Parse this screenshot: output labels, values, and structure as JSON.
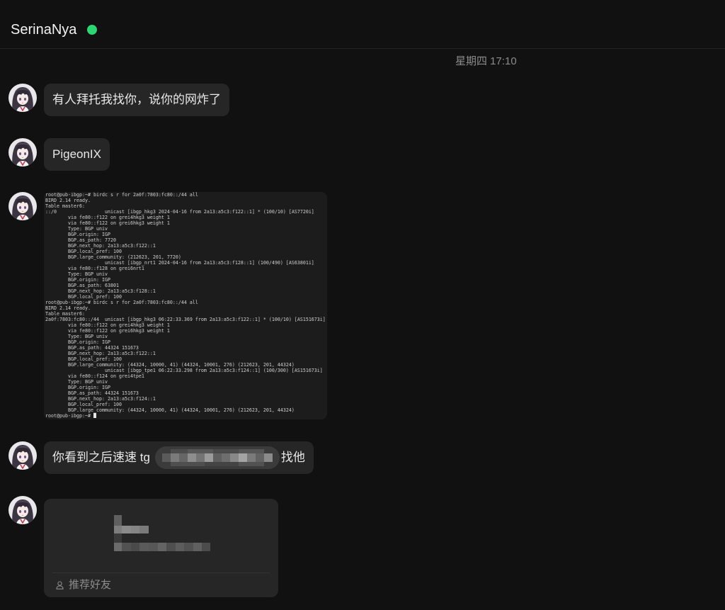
{
  "header": {
    "title": "SerinaNya",
    "status_icon": "online-dot-icon"
  },
  "timestamp": "星期四 17:10",
  "messages": [
    {
      "text": "有人拜托我找你，说你的网炸了"
    },
    {
      "text": "PigeonIX"
    },
    {
      "terminal_lines": [
        "root@pub-ibgp:~# birdc s r for 2a0f:7803:fc80::/44 all",
        "BIRD 2.14 ready.",
        "Table master6:",
        "::/0                 unicast [ibgp_hkg3 2024-04-16 from 2a13:a5c3:f122::1] * (100/10) [AS7720i]",
        "\tvia fe80::f122 on grei4hkg3 weight 1",
        "\tvia fe80::f122 on grei6hkg3 weight 1",
        "\tType: BGP univ",
        "\tBGP.origin: IGP",
        "\tBGP.as_path: 7720",
        "\tBGP.next_hop: 2a13:a5c3:f122::1",
        "\tBGP.local_pref: 100",
        "\tBGP.large_community: (212623, 201, 7720)",
        "                     unicast [ibgp_nrt1 2024-04-16 from 2a13:a5c3:f128::1] (100/490) [AS63801i]",
        "\tvia fe80::f128 on grei6nrt1",
        "\tType: BGP univ",
        "\tBGP.origin: IGP",
        "\tBGP.as_path: 63801",
        "\tBGP.next_hop: 2a13:a5c3:f128::1",
        "\tBGP.local_pref: 100",
        "root@pub-ibgp:~# birdc s r for 2a0f:7803:fc80::/44 all",
        "BIRD 2.14 ready.",
        "Table master6:",
        "2a0f:7803:fc80::/44  unicast [ibgp_hkg3 06:22:33.369 from 2a13:a5c3:f122::1] * (100/10) [AS151673i]",
        "\tvia fe80::f122 on grei4hkg3 weight 1",
        "\tvia fe80::f122 on grei6hkg3 weight 1",
        "\tType: BGP univ",
        "\tBGP.origin: IGP",
        "\tBGP.as_path: 44324 151673",
        "\tBGP.next_hop: 2a13:a5c3:f122::1",
        "\tBGP.local_pref: 100",
        "\tBGP.large_community: (44324, 10000, 41) (44324, 10001, 276) (212623, 201, 44324)",
        "                     unicast [ibgp_tpe1 06:22:33.298 from 2a13:a5c3:f124::1] (100/300) [AS151673i]",
        "\tvia fe80::f124 on grei4tpe1",
        "\tType: BGP univ",
        "\tBGP.origin: IGP",
        "\tBGP.as_path: 44324 151673",
        "\tBGP.next_hop: 2a13:a5c3:f124::1",
        "\tBGP.local_pref: 100",
        "\tBGP.large_community: (44324, 10000, 41) (44324, 10001, 276) (212623, 201, 44324)",
        "root@pub-ibgp:~#"
      ]
    },
    {
      "text_before": "你看到之后速速 tg",
      "text_after": "找他"
    },
    {
      "footer_icon": "person-icon",
      "footer_label": "推荐好友"
    }
  ],
  "colors": {
    "background": "#111111",
    "divider": "#222222",
    "bubble": "#262626",
    "terminal_background": "#1c1c1c",
    "terminal_text": "#cfcfcf",
    "text": "#e8e8e8",
    "muted_text": "#8c8c8c",
    "online": "#2ed573"
  }
}
